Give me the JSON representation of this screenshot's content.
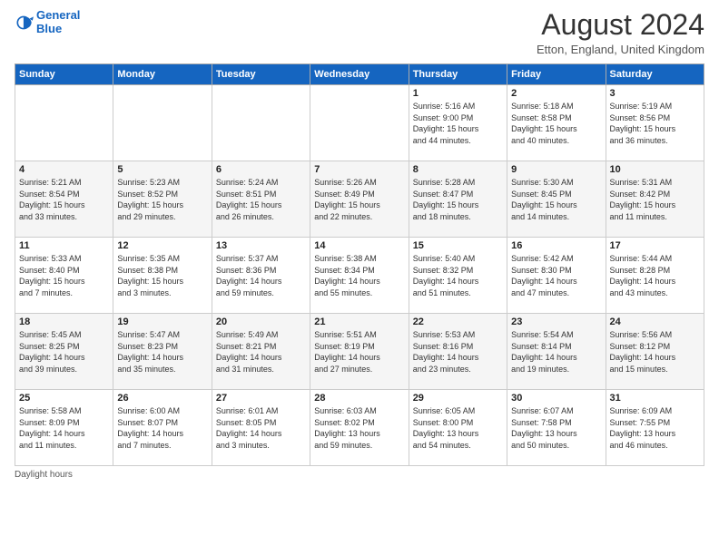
{
  "header": {
    "logo_line1": "General",
    "logo_line2": "Blue",
    "month_year": "August 2024",
    "location": "Etton, England, United Kingdom"
  },
  "days_of_week": [
    "Sunday",
    "Monday",
    "Tuesday",
    "Wednesday",
    "Thursday",
    "Friday",
    "Saturday"
  ],
  "weeks": [
    [
      {
        "day": "",
        "content": ""
      },
      {
        "day": "",
        "content": ""
      },
      {
        "day": "",
        "content": ""
      },
      {
        "day": "",
        "content": ""
      },
      {
        "day": "1",
        "content": "Sunrise: 5:16 AM\nSunset: 9:00 PM\nDaylight: 15 hours\nand 44 minutes."
      },
      {
        "day": "2",
        "content": "Sunrise: 5:18 AM\nSunset: 8:58 PM\nDaylight: 15 hours\nand 40 minutes."
      },
      {
        "day": "3",
        "content": "Sunrise: 5:19 AM\nSunset: 8:56 PM\nDaylight: 15 hours\nand 36 minutes."
      }
    ],
    [
      {
        "day": "4",
        "content": "Sunrise: 5:21 AM\nSunset: 8:54 PM\nDaylight: 15 hours\nand 33 minutes."
      },
      {
        "day": "5",
        "content": "Sunrise: 5:23 AM\nSunset: 8:52 PM\nDaylight: 15 hours\nand 29 minutes."
      },
      {
        "day": "6",
        "content": "Sunrise: 5:24 AM\nSunset: 8:51 PM\nDaylight: 15 hours\nand 26 minutes."
      },
      {
        "day": "7",
        "content": "Sunrise: 5:26 AM\nSunset: 8:49 PM\nDaylight: 15 hours\nand 22 minutes."
      },
      {
        "day": "8",
        "content": "Sunrise: 5:28 AM\nSunset: 8:47 PM\nDaylight: 15 hours\nand 18 minutes."
      },
      {
        "day": "9",
        "content": "Sunrise: 5:30 AM\nSunset: 8:45 PM\nDaylight: 15 hours\nand 14 minutes."
      },
      {
        "day": "10",
        "content": "Sunrise: 5:31 AM\nSunset: 8:42 PM\nDaylight: 15 hours\nand 11 minutes."
      }
    ],
    [
      {
        "day": "11",
        "content": "Sunrise: 5:33 AM\nSunset: 8:40 PM\nDaylight: 15 hours\nand 7 minutes."
      },
      {
        "day": "12",
        "content": "Sunrise: 5:35 AM\nSunset: 8:38 PM\nDaylight: 15 hours\nand 3 minutes."
      },
      {
        "day": "13",
        "content": "Sunrise: 5:37 AM\nSunset: 8:36 PM\nDaylight: 14 hours\nand 59 minutes."
      },
      {
        "day": "14",
        "content": "Sunrise: 5:38 AM\nSunset: 8:34 PM\nDaylight: 14 hours\nand 55 minutes."
      },
      {
        "day": "15",
        "content": "Sunrise: 5:40 AM\nSunset: 8:32 PM\nDaylight: 14 hours\nand 51 minutes."
      },
      {
        "day": "16",
        "content": "Sunrise: 5:42 AM\nSunset: 8:30 PM\nDaylight: 14 hours\nand 47 minutes."
      },
      {
        "day": "17",
        "content": "Sunrise: 5:44 AM\nSunset: 8:28 PM\nDaylight: 14 hours\nand 43 minutes."
      }
    ],
    [
      {
        "day": "18",
        "content": "Sunrise: 5:45 AM\nSunset: 8:25 PM\nDaylight: 14 hours\nand 39 minutes."
      },
      {
        "day": "19",
        "content": "Sunrise: 5:47 AM\nSunset: 8:23 PM\nDaylight: 14 hours\nand 35 minutes."
      },
      {
        "day": "20",
        "content": "Sunrise: 5:49 AM\nSunset: 8:21 PM\nDaylight: 14 hours\nand 31 minutes."
      },
      {
        "day": "21",
        "content": "Sunrise: 5:51 AM\nSunset: 8:19 PM\nDaylight: 14 hours\nand 27 minutes."
      },
      {
        "day": "22",
        "content": "Sunrise: 5:53 AM\nSunset: 8:16 PM\nDaylight: 14 hours\nand 23 minutes."
      },
      {
        "day": "23",
        "content": "Sunrise: 5:54 AM\nSunset: 8:14 PM\nDaylight: 14 hours\nand 19 minutes."
      },
      {
        "day": "24",
        "content": "Sunrise: 5:56 AM\nSunset: 8:12 PM\nDaylight: 14 hours\nand 15 minutes."
      }
    ],
    [
      {
        "day": "25",
        "content": "Sunrise: 5:58 AM\nSunset: 8:09 PM\nDaylight: 14 hours\nand 11 minutes."
      },
      {
        "day": "26",
        "content": "Sunrise: 6:00 AM\nSunset: 8:07 PM\nDaylight: 14 hours\nand 7 minutes."
      },
      {
        "day": "27",
        "content": "Sunrise: 6:01 AM\nSunset: 8:05 PM\nDaylight: 14 hours\nand 3 minutes."
      },
      {
        "day": "28",
        "content": "Sunrise: 6:03 AM\nSunset: 8:02 PM\nDaylight: 13 hours\nand 59 minutes."
      },
      {
        "day": "29",
        "content": "Sunrise: 6:05 AM\nSunset: 8:00 PM\nDaylight: 13 hours\nand 54 minutes."
      },
      {
        "day": "30",
        "content": "Sunrise: 6:07 AM\nSunset: 7:58 PM\nDaylight: 13 hours\nand 50 minutes."
      },
      {
        "day": "31",
        "content": "Sunrise: 6:09 AM\nSunset: 7:55 PM\nDaylight: 13 hours\nand 46 minutes."
      }
    ]
  ],
  "footer": {
    "daylight_label": "Daylight hours"
  }
}
